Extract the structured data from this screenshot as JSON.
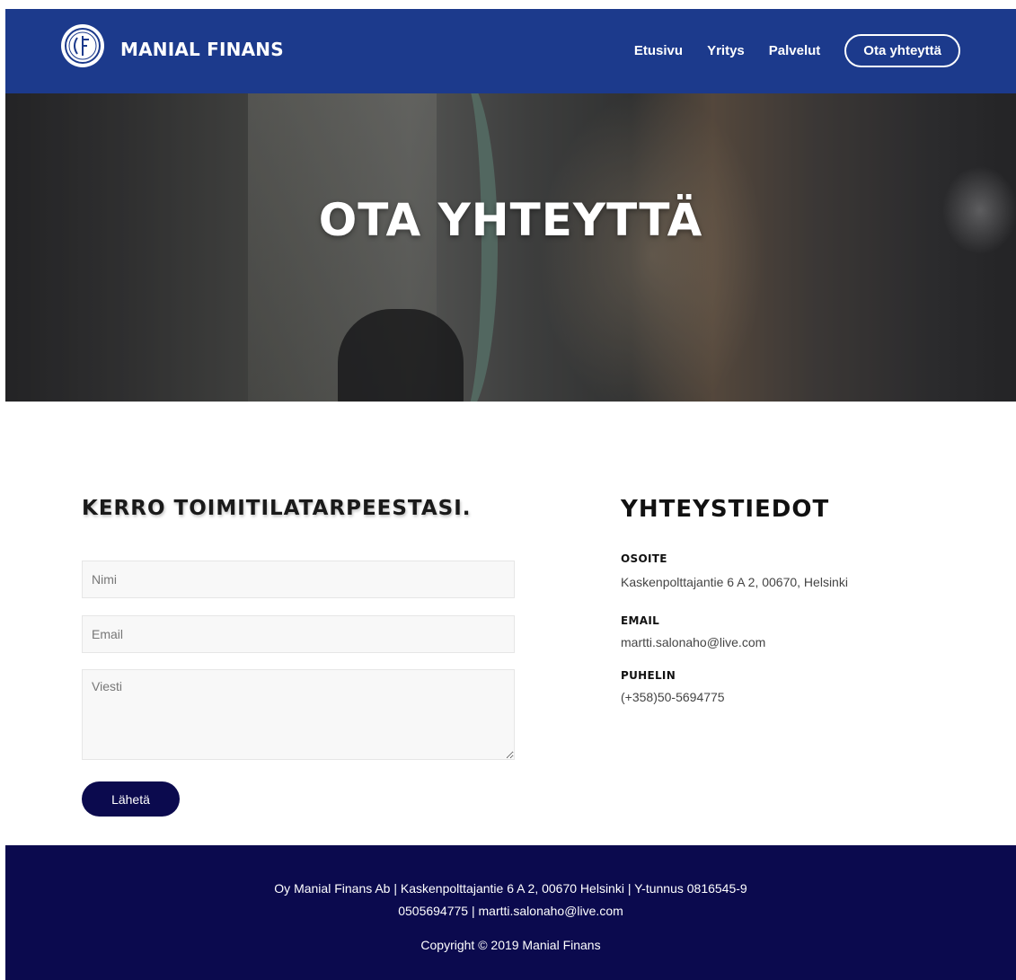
{
  "header": {
    "brand": "MANIAL FINANS",
    "logo_icon": "company-logo-icon",
    "nav": [
      {
        "label": "Etusivu"
      },
      {
        "label": "Yritys"
      },
      {
        "label": "Palvelut"
      },
      {
        "label": "Ota yhteyttä"
      }
    ]
  },
  "hero": {
    "title": "OTA YHTEYTTÄ"
  },
  "form": {
    "title": "KERRO TOIMITILATARPEESTASI.",
    "name_placeholder": "Nimi",
    "email_placeholder": "Email",
    "message_placeholder": "Viesti",
    "submit_label": "Lähetä"
  },
  "contact": {
    "title": "YHTEYSTIEDOT",
    "address_label": "OSOITE",
    "address_value": "Kaskenpolttajantie 6 A 2, 00670, Helsinki",
    "email_label": "EMAIL",
    "email_value": "martti.salonaho@live.com",
    "phone_label": "PUHELIN",
    "phone_value": "(+358)50-5694775"
  },
  "footer": {
    "line1": "Oy Manial Finans Ab | Kaskenpolttajantie 6 A 2, 00670 Helsinki | Y-tunnus 0816545-9",
    "line2": "0505694775 | martti.salonaho@live.com",
    "line3": "Copyright © 2019 Manial Finans"
  },
  "colors": {
    "header_bg": "#1c3a8c",
    "footer_bg": "#0b0a4e",
    "button_bg": "#0b0a4e"
  }
}
